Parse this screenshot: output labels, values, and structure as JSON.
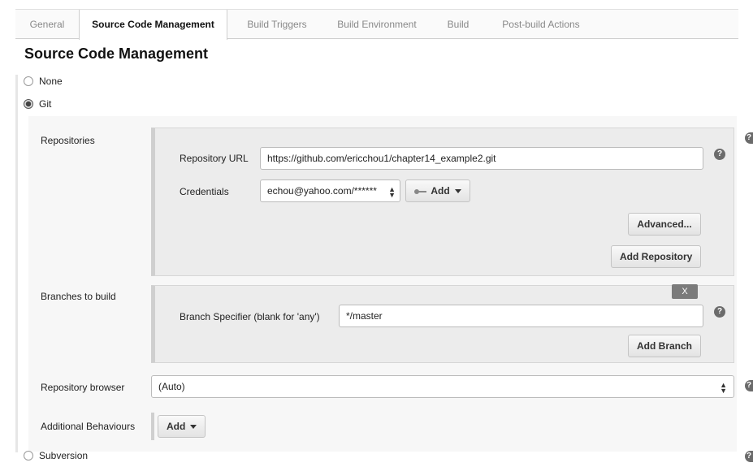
{
  "tabs": [
    "General",
    "Source Code Management",
    "Build Triggers",
    "Build Environment",
    "Build",
    "Post-build Actions"
  ],
  "section_title": "Source Code Management",
  "scm_options": {
    "none": "None",
    "git": "Git",
    "subversion": "Subversion",
    "selected": "Git"
  },
  "repositories": {
    "label": "Repositories",
    "url_label": "Repository URL",
    "url_value": "https://github.com/ericchou1/chapter14_example2.git",
    "credentials_label": "Credentials",
    "credentials_value": "echou@yahoo.com/******",
    "add_credentials": "Add",
    "advanced_button": "Advanced...",
    "add_repository_button": "Add Repository"
  },
  "branches": {
    "label": "Branches to build",
    "delete_button": "X",
    "specifier_label": "Branch Specifier (blank for 'any')",
    "specifier_value": "*/master",
    "add_branch_button": "Add Branch"
  },
  "repo_browser": {
    "label": "Repository browser",
    "value": "(Auto)"
  },
  "additional": {
    "label": "Additional Behaviours",
    "add_button": "Add"
  },
  "icons": {
    "help": "help-icon",
    "key": "key-icon",
    "dropdown": "caret-down-icon",
    "select": "select-arrows-icon"
  },
  "help_glyph": "?"
}
